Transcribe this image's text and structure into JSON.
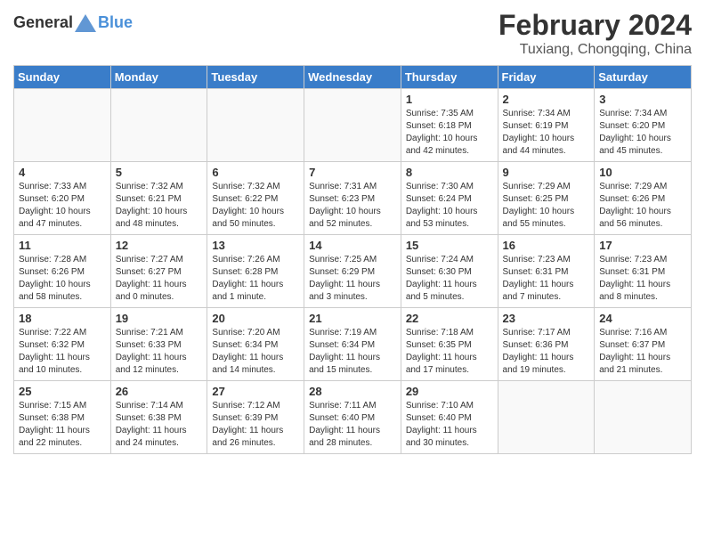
{
  "header": {
    "logo_general": "General",
    "logo_blue": "Blue",
    "month": "February 2024",
    "location": "Tuxiang, Chongqing, China"
  },
  "days_of_week": [
    "Sunday",
    "Monday",
    "Tuesday",
    "Wednesday",
    "Thursday",
    "Friday",
    "Saturday"
  ],
  "weeks": [
    [
      {
        "day": "",
        "info": ""
      },
      {
        "day": "",
        "info": ""
      },
      {
        "day": "",
        "info": ""
      },
      {
        "day": "",
        "info": ""
      },
      {
        "day": "1",
        "info": "Sunrise: 7:35 AM\nSunset: 6:18 PM\nDaylight: 10 hours\nand 42 minutes."
      },
      {
        "day": "2",
        "info": "Sunrise: 7:34 AM\nSunset: 6:19 PM\nDaylight: 10 hours\nand 44 minutes."
      },
      {
        "day": "3",
        "info": "Sunrise: 7:34 AM\nSunset: 6:20 PM\nDaylight: 10 hours\nand 45 minutes."
      }
    ],
    [
      {
        "day": "4",
        "info": "Sunrise: 7:33 AM\nSunset: 6:20 PM\nDaylight: 10 hours\nand 47 minutes."
      },
      {
        "day": "5",
        "info": "Sunrise: 7:32 AM\nSunset: 6:21 PM\nDaylight: 10 hours\nand 48 minutes."
      },
      {
        "day": "6",
        "info": "Sunrise: 7:32 AM\nSunset: 6:22 PM\nDaylight: 10 hours\nand 50 minutes."
      },
      {
        "day": "7",
        "info": "Sunrise: 7:31 AM\nSunset: 6:23 PM\nDaylight: 10 hours\nand 52 minutes."
      },
      {
        "day": "8",
        "info": "Sunrise: 7:30 AM\nSunset: 6:24 PM\nDaylight: 10 hours\nand 53 minutes."
      },
      {
        "day": "9",
        "info": "Sunrise: 7:29 AM\nSunset: 6:25 PM\nDaylight: 10 hours\nand 55 minutes."
      },
      {
        "day": "10",
        "info": "Sunrise: 7:29 AM\nSunset: 6:26 PM\nDaylight: 10 hours\nand 56 minutes."
      }
    ],
    [
      {
        "day": "11",
        "info": "Sunrise: 7:28 AM\nSunset: 6:26 PM\nDaylight: 10 hours\nand 58 minutes."
      },
      {
        "day": "12",
        "info": "Sunrise: 7:27 AM\nSunset: 6:27 PM\nDaylight: 11 hours\nand 0 minutes."
      },
      {
        "day": "13",
        "info": "Sunrise: 7:26 AM\nSunset: 6:28 PM\nDaylight: 11 hours\nand 1 minute."
      },
      {
        "day": "14",
        "info": "Sunrise: 7:25 AM\nSunset: 6:29 PM\nDaylight: 11 hours\nand 3 minutes."
      },
      {
        "day": "15",
        "info": "Sunrise: 7:24 AM\nSunset: 6:30 PM\nDaylight: 11 hours\nand 5 minutes."
      },
      {
        "day": "16",
        "info": "Sunrise: 7:23 AM\nSunset: 6:31 PM\nDaylight: 11 hours\nand 7 minutes."
      },
      {
        "day": "17",
        "info": "Sunrise: 7:23 AM\nSunset: 6:31 PM\nDaylight: 11 hours\nand 8 minutes."
      }
    ],
    [
      {
        "day": "18",
        "info": "Sunrise: 7:22 AM\nSunset: 6:32 PM\nDaylight: 11 hours\nand 10 minutes."
      },
      {
        "day": "19",
        "info": "Sunrise: 7:21 AM\nSunset: 6:33 PM\nDaylight: 11 hours\nand 12 minutes."
      },
      {
        "day": "20",
        "info": "Sunrise: 7:20 AM\nSunset: 6:34 PM\nDaylight: 11 hours\nand 14 minutes."
      },
      {
        "day": "21",
        "info": "Sunrise: 7:19 AM\nSunset: 6:34 PM\nDaylight: 11 hours\nand 15 minutes."
      },
      {
        "day": "22",
        "info": "Sunrise: 7:18 AM\nSunset: 6:35 PM\nDaylight: 11 hours\nand 17 minutes."
      },
      {
        "day": "23",
        "info": "Sunrise: 7:17 AM\nSunset: 6:36 PM\nDaylight: 11 hours\nand 19 minutes."
      },
      {
        "day": "24",
        "info": "Sunrise: 7:16 AM\nSunset: 6:37 PM\nDaylight: 11 hours\nand 21 minutes."
      }
    ],
    [
      {
        "day": "25",
        "info": "Sunrise: 7:15 AM\nSunset: 6:38 PM\nDaylight: 11 hours\nand 22 minutes."
      },
      {
        "day": "26",
        "info": "Sunrise: 7:14 AM\nSunset: 6:38 PM\nDaylight: 11 hours\nand 24 minutes."
      },
      {
        "day": "27",
        "info": "Sunrise: 7:12 AM\nSunset: 6:39 PM\nDaylight: 11 hours\nand 26 minutes."
      },
      {
        "day": "28",
        "info": "Sunrise: 7:11 AM\nSunset: 6:40 PM\nDaylight: 11 hours\nand 28 minutes."
      },
      {
        "day": "29",
        "info": "Sunrise: 7:10 AM\nSunset: 6:40 PM\nDaylight: 11 hours\nand 30 minutes."
      },
      {
        "day": "",
        "info": ""
      },
      {
        "day": "",
        "info": ""
      }
    ]
  ]
}
